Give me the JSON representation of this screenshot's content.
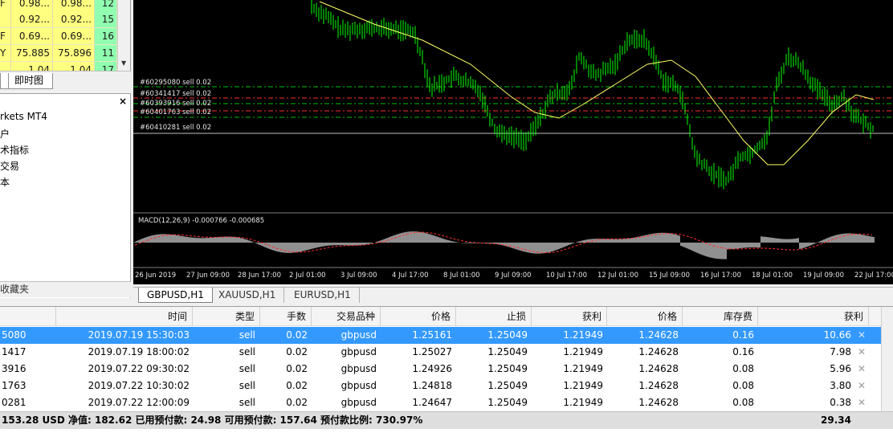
{
  "market_watch": {
    "rows": [
      {
        "symbol": "F",
        "bid": "0.98...",
        "ask": "0.98...",
        "spread": "12"
      },
      {
        "symbol": "",
        "bid": "0.92...",
        "ask": "0.92...",
        "spread": "15"
      },
      {
        "symbol": "F",
        "bid": "0.69...",
        "ask": "0.69...",
        "spread": "16"
      },
      {
        "symbol": "Y",
        "bid": "75.885",
        "ask": "75.896",
        "spread": "11"
      },
      {
        "symbol": "",
        "bid": "1.04",
        "ask": "1.04",
        "spread": "17"
      }
    ],
    "tabs": [
      "",
      "即时图"
    ]
  },
  "navigator": {
    "close_label": "×",
    "items": [
      "rkets MT4",
      "户",
      "术指标",
      "交易",
      "本"
    ],
    "bottom_tab": "收藏夹"
  },
  "chart": {
    "order_lines": [
      "#60295080 sell 0.02",
      "#60341417 sell 0.02",
      "#60393916 sell 0.02",
      "#60401763 sell 0.02",
      "#60410281 sell 0.02"
    ],
    "macd_label": "MACD(12,26,9) -0.000766 -0.000685",
    "dates": [
      "26 Jun 2019",
      "27 Jun 09:00",
      "28 Jun 17:00",
      "2 Jul 01:00",
      "3 Jul 09:00",
      "4 Jul 17:00",
      "8 Jul 01:00",
      "9 Jul 09:00",
      "10 Jul 17:00",
      "12 Jul 01:00",
      "15 Jul 09:00",
      "16 Jul 17:00",
      "18 Jul 01:00",
      "19 Jul 09:00",
      "22 Jul 17:00"
    ],
    "colors": {
      "candles": "#00ff00",
      "ma": "#ffff66",
      "order_line_green": "#00c000",
      "order_line_red": "#ff3030",
      "histogram": "#c0c0c0",
      "signal": "#ff3030"
    }
  },
  "chart_tabs": [
    "GBPUSD,H1",
    "XAUUSD,H1",
    "EURUSD,H1"
  ],
  "trade": {
    "headers": [
      "",
      "时间",
      "类型",
      "手数",
      "交易品种",
      "价格",
      "止损",
      "获利",
      "价格",
      "库存费",
      "获利"
    ],
    "rows": [
      {
        "id": "5080",
        "time": "2019.07.19 15:30:03",
        "type": "sell",
        "lots": "0.02",
        "symbol": "gbpusd",
        "price": "1.25161",
        "sl": "1.25049",
        "tp": "1.21949",
        "cur": "1.24628",
        "swap": "0.16",
        "profit": "10.66",
        "x": "✕"
      },
      {
        "id": "1417",
        "time": "2019.07.19 18:00:02",
        "type": "sell",
        "lots": "0.02",
        "symbol": "gbpusd",
        "price": "1.25027",
        "sl": "1.25049",
        "tp": "1.21949",
        "cur": "1.24628",
        "swap": "0.16",
        "profit": "7.98",
        "x": "✕"
      },
      {
        "id": "3916",
        "time": "2019.07.22 09:30:02",
        "type": "sell",
        "lots": "0.02",
        "symbol": "gbpusd",
        "price": "1.24926",
        "sl": "1.25049",
        "tp": "1.21949",
        "cur": "1.24628",
        "swap": "0.08",
        "profit": "5.96",
        "x": "✕"
      },
      {
        "id": "1763",
        "time": "2019.07.22 10:30:02",
        "type": "sell",
        "lots": "0.02",
        "symbol": "gbpusd",
        "price": "1.24818",
        "sl": "1.25049",
        "tp": "1.21949",
        "cur": "1.24628",
        "swap": "0.08",
        "profit": "3.80",
        "x": "✕"
      },
      {
        "id": "0281",
        "time": "2019.07.22 12:00:09",
        "type": "sell",
        "lots": "0.02",
        "symbol": "gbpusd",
        "price": "1.24647",
        "sl": "1.25049",
        "tp": "1.21949",
        "cur": "1.24628",
        "swap": "0.08",
        "profit": "0.38",
        "x": "✕"
      }
    ],
    "summary": "153.28 USD  净值: 182.62  已用预付款: 24.98  可用预付款: 157.64  预付款比例: 730.97%",
    "summary_profit": "29.34"
  }
}
